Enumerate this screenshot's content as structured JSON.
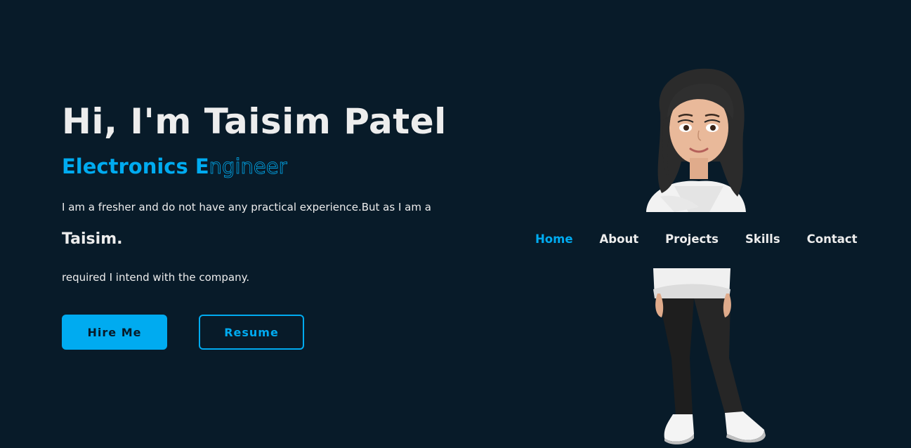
{
  "hero": {
    "title": "Hi, I'm Taisim Patel",
    "role_filled": "Electronics E",
    "role_outline": "ngineer",
    "paragraph_line1": "I am a fresher and do not have any practical experience.But as I am a",
    "name": "Taisim.",
    "paragraph_line3": "required I intend with the company."
  },
  "buttons": {
    "hire": "Hire Me",
    "resume": "Resume"
  },
  "nav": {
    "items": [
      "Home",
      "About",
      "Projects",
      "Skills",
      "Contact"
    ],
    "active": "Home"
  },
  "colors": {
    "background": "#081b29",
    "accent": "#00abf0",
    "text": "#ededed"
  },
  "avatar": {
    "icon": "avatar-illustration"
  }
}
